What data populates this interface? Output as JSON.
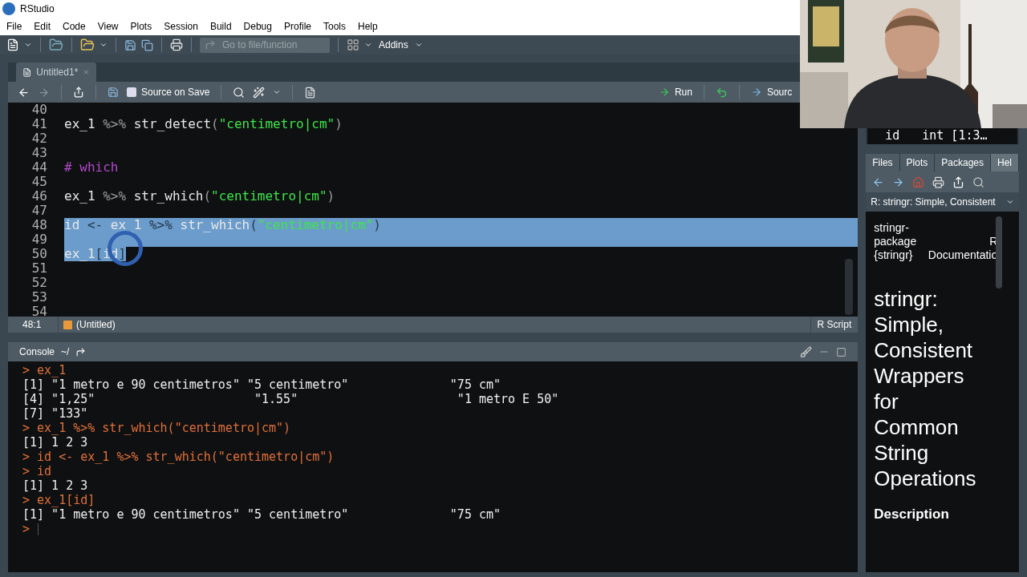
{
  "window": {
    "title": "RStudio"
  },
  "menu": [
    "File",
    "Edit",
    "Code",
    "View",
    "Plots",
    "Session",
    "Build",
    "Debug",
    "Profile",
    "Tools",
    "Help"
  ],
  "toolbar": {
    "goto_placeholder": "Go to file/function",
    "addins": "Addins"
  },
  "editor": {
    "tab": {
      "label": "Untitled1*",
      "selected": true
    },
    "source_on_save": {
      "label": "Source on Save",
      "checked": false
    },
    "run": "Run",
    "source": "Sourc",
    "lines": [
      {
        "number": "40",
        "selected": false
      },
      {
        "number": "41",
        "selected": false,
        "tokens": [
          {
            "kind": "plain",
            "text": "ex_1 "
          },
          {
            "kind": "operator",
            "text": "%>%"
          },
          {
            "kind": "plain",
            "text": " str_detect"
          },
          {
            "kind": "operator",
            "text": "("
          },
          {
            "kind": "string",
            "text": "\"centimetro|cm\""
          },
          {
            "kind": "operator",
            "text": ")"
          }
        ]
      },
      {
        "number": "42",
        "selected": false
      },
      {
        "number": "43",
        "selected": false
      },
      {
        "number": "44",
        "selected": false,
        "tokens": [
          {
            "kind": "comment",
            "text": "# which"
          }
        ]
      },
      {
        "number": "45",
        "selected": false
      },
      {
        "number": "46",
        "selected": false,
        "tokens": [
          {
            "kind": "plain",
            "text": "ex_1 "
          },
          {
            "kind": "operator",
            "text": "%>%"
          },
          {
            "kind": "plain",
            "text": " str_which"
          },
          {
            "kind": "operator",
            "text": "("
          },
          {
            "kind": "string",
            "text": "\"centimetro|cm\""
          },
          {
            "kind": "operator",
            "text": ")"
          }
        ]
      },
      {
        "number": "47",
        "selected": false
      },
      {
        "number": "48",
        "selected": true,
        "tokens": [
          {
            "kind": "plain",
            "text": "id "
          },
          {
            "kind": "operator",
            "text": "<-"
          },
          {
            "kind": "plain",
            "text": " ex_1 "
          },
          {
            "kind": "operator",
            "text": "%>%"
          },
          {
            "kind": "plain",
            "text": " str_which"
          },
          {
            "kind": "operator",
            "text": "("
          },
          {
            "kind": "string",
            "text": "\"centimetro|cm\""
          },
          {
            "kind": "operator",
            "text": ")"
          }
        ]
      },
      {
        "number": "49",
        "selected": true
      },
      {
        "number": "50",
        "selected": true,
        "tokens": [
          {
            "kind": "plain",
            "text": "ex_1"
          },
          {
            "kind": "operator",
            "text": "["
          },
          {
            "kind": "plain",
            "text": "id"
          },
          {
            "kind": "operator",
            "text": "]"
          }
        ]
      },
      {
        "number": "51",
        "selected": false
      },
      {
        "number": "52",
        "selected": false
      },
      {
        "number": "53",
        "selected": false
      },
      {
        "number": "54",
        "selected": false
      }
    ],
    "position": "48:1",
    "scope": "(Untitled)",
    "file_type": "R Script"
  },
  "console": {
    "title": "Console",
    "path": "~/",
    "lines": [
      {
        "kind": "input",
        "prompt": ">",
        "text": "ex_1"
      },
      {
        "kind": "output",
        "text": "[1] \"1 metro e 90 centimetros\" \"5 centimetro\"              \"75 cm\""
      },
      {
        "kind": "output",
        "text": "[4] \"1,25\"                      \"1.55\"                      \"1 metro E 50\""
      },
      {
        "kind": "output",
        "text": "[7] \"133\""
      },
      {
        "kind": "input",
        "prompt": ">",
        "text": "ex_1 %>% str_which(\"centimetro|cm\")"
      },
      {
        "kind": "output",
        "text": "[1] 1 2 3"
      },
      {
        "kind": "input",
        "prompt": ">",
        "text": "id <- ex_1 %>% str_which(\"centimetro|cm\")"
      },
      {
        "kind": "input",
        "prompt": ">",
        "text": "id"
      },
      {
        "kind": "output",
        "text": "[1] 1 2 3"
      },
      {
        "kind": "input",
        "prompt": ">",
        "text": "ex_1[id]"
      },
      {
        "kind": "output",
        "text": "[1] \"1 metro e 90 centimetros\" \"5 centimetro\"              \"75 cm\""
      },
      {
        "kind": "prompt",
        "prompt": ">"
      }
    ]
  },
  "environment": {
    "rows": [
      {
        "name": "id",
        "value": "int [1:3…"
      }
    ]
  },
  "help": {
    "tabs": [
      {
        "label": "Files",
        "selected": false
      },
      {
        "label": "Plots",
        "selected": false
      },
      {
        "label": "Packages",
        "selected": false
      },
      {
        "label": "Hel",
        "selected": true
      }
    ],
    "topic": "R: stringr: Simple, Consistent",
    "package_label": "stringr-package {stringr}",
    "doc_label": "R Documentatio",
    "title": "stringr: Simple, Consistent Wrappers for Common String Operations",
    "section": "Description"
  }
}
